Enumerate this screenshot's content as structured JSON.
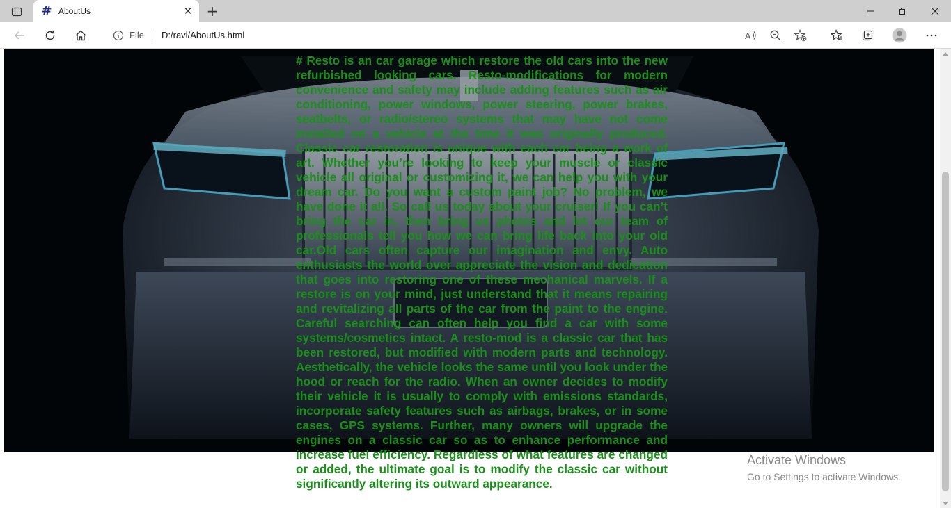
{
  "browser": {
    "tab": {
      "title": "AboutUs",
      "favicon": "#"
    },
    "address": {
      "scheme_label": "File",
      "url": "D:/ravi/AboutUs.html"
    }
  },
  "page": {
    "about_text": "# Resto is an car garage which restore the old cars into the new refurbished looking cars. Resto-modifications for modern convenience and safety may include adding features such as air conditioning, power windows, power steering, power brakes, seatbelts, or radio/stereo systems that may have not come installed on a vehicle at the time it was originally produced. Classic car restoration is unique with each car being a work of art. Whether you’re looking to keep your muscle or classic vehicle all original or customizing it, we can help you with your dream car. Do you want a custom paint job? No problem, we have done it all. So call us today about your cruiser! If you can’t bring the car in, then bring us photos and let our team of professionals tell you how we can bring life back into your old car.Old cars often capture our imagination and envy. Auto enthusiasts the world over appreciate the vision and dedication that goes into restoring one of these mechanical marvels. If a restore is on your mind, just understand that it means repairing and revitalizing all parts of the car from the paint to the engine. Careful searching can often help you find a car with some systems/cosmetics intact. A resto-mod is a classic car that has been restored, but modified with modern parts and technology. Aesthetically, the vehicle looks the same until you look under the hood or reach for the radio. When an owner decides to modify their vehicle it is usually to comply with emissions standards, incorporate safety features such as airbags, brakes, or in some cases, GPS systems. Further, many owners will upgrade the engines on a classic car so as to enhance performance and increase fuel efficiency. Regardless of what features are changed or added, the ultimate goal is to modify the classic car without significantly altering its outward appearance.",
    "text_color": "#1a8f1a"
  },
  "watermark": {
    "line1": "Activate Windows",
    "line2": "Go to Settings to activate Windows."
  }
}
